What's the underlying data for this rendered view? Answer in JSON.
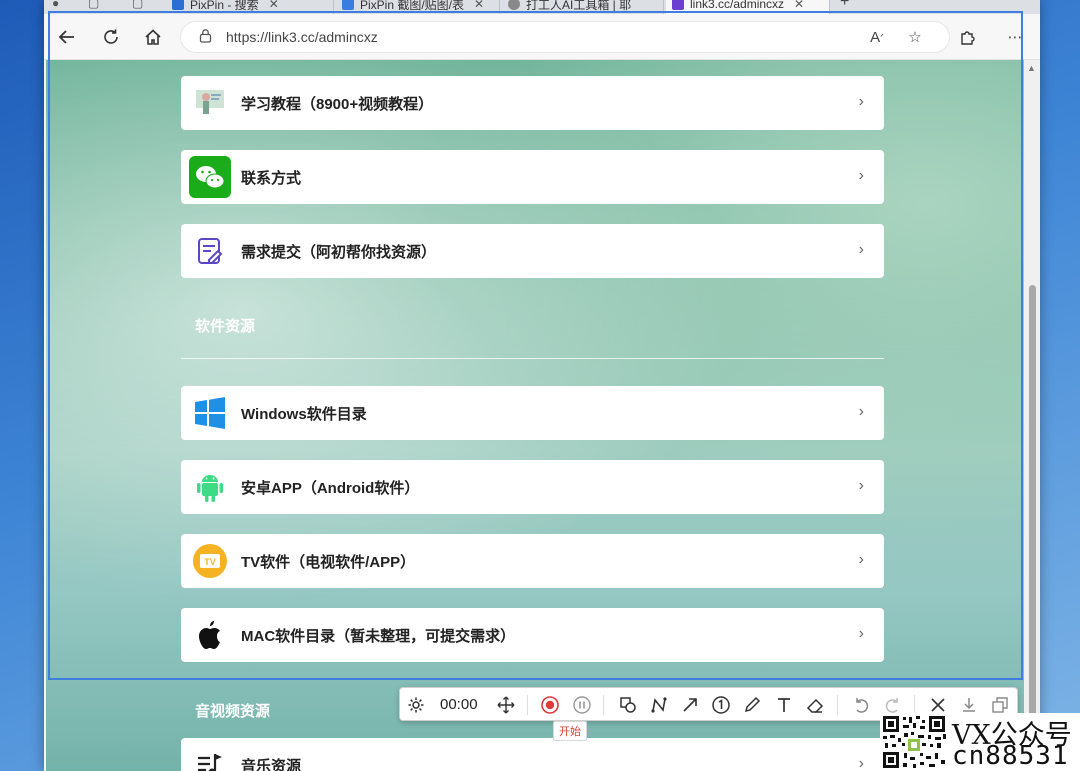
{
  "tabs": [
    {
      "label": "PixPin - 搜索",
      "favicon_color": "#2b6fd6"
    },
    {
      "label": "PixPin 截图/贴图/表",
      "favicon_color": "#3a7de0"
    },
    {
      "label": "打工人AI工具箱 | 耶",
      "favicon_color": "#888888"
    },
    {
      "label": "link3.cc/admincxz",
      "favicon_color": "#6a3fd0",
      "active": true
    }
  ],
  "address": {
    "url": "https://link3.cc/admincxz"
  },
  "sections": {
    "software": "软件资源",
    "media": "音视频资源"
  },
  "items": [
    {
      "label": "学习教程（8900+视频教程）",
      "icon": "tutorial-icon"
    },
    {
      "label": "联系方式",
      "icon": "wechat-icon"
    },
    {
      "label": "需求提交（阿初帮你找资源）",
      "icon": "edit-form-icon"
    },
    {
      "label": "Windows软件目录",
      "icon": "windows-icon"
    },
    {
      "label": "安卓APP（Android软件）",
      "icon": "android-icon"
    },
    {
      "label": "TV软件（电视软件/APP）",
      "icon": "tv-icon"
    },
    {
      "label": "MAC软件目录（暂未整理，可提交需求）",
      "icon": "apple-icon"
    },
    {
      "label": "音乐资源",
      "icon": "music-icon"
    }
  ],
  "capture_toolbar": {
    "timer": "00:00",
    "tooltip": "开始"
  },
  "watermark": {
    "line1": "VX公众号",
    "line2": "cn88531"
  },
  "colors": {
    "selection": "#3f7ee0",
    "wechat": "#1aad19",
    "windows": "#1e90e6",
    "android": "#3ddc84",
    "tv": "#f5b324",
    "record": "#e03a3a"
  }
}
